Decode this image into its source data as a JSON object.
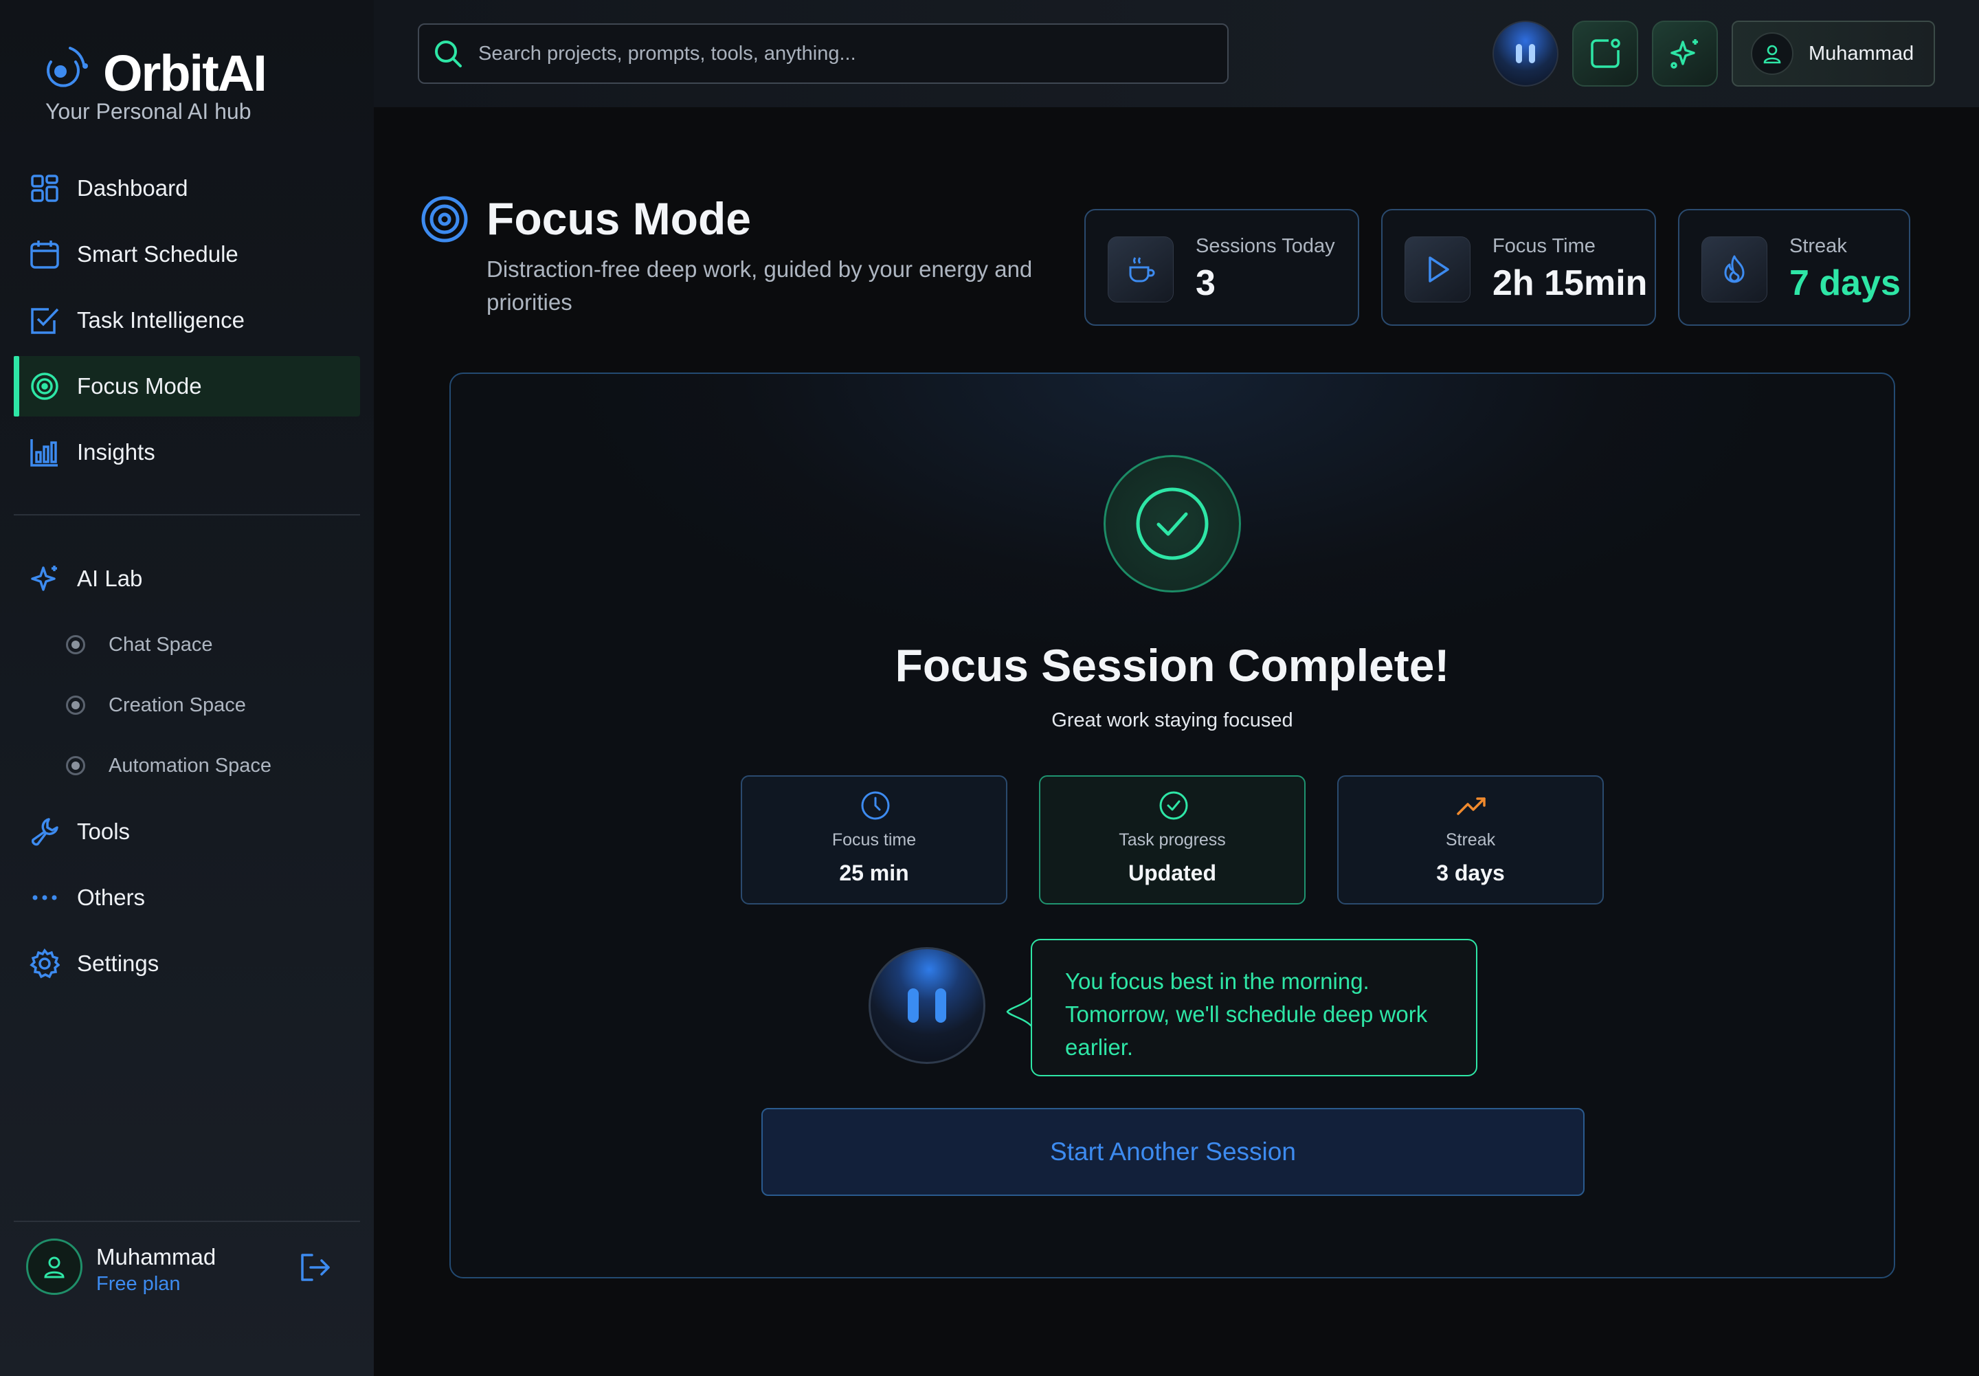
{
  "brand": {
    "name": "OrbitAI",
    "tagline": "Your Personal AI hub"
  },
  "nav": {
    "items": [
      {
        "label": "Dashboard",
        "icon": "dashboard-grid-icon"
      },
      {
        "label": "Smart Schedule",
        "icon": "calendar-icon"
      },
      {
        "label": "Task Intelligence",
        "icon": "task-check-icon"
      },
      {
        "label": "Focus Mode",
        "icon": "target-icon",
        "active": true
      },
      {
        "label": "Insights",
        "icon": "bar-chart-icon"
      }
    ],
    "ai_lab": {
      "label": "AI Lab",
      "icon": "sparkle-icon",
      "children": [
        {
          "label": "Chat Space"
        },
        {
          "label": "Creation Space"
        },
        {
          "label": "Automation Space"
        }
      ]
    },
    "bottom_items": [
      {
        "label": "Tools",
        "icon": "wrench-icon"
      },
      {
        "label": "Others",
        "icon": "ellipsis-icon"
      },
      {
        "label": "Settings",
        "icon": "gear-icon"
      }
    ]
  },
  "sidebar_user": {
    "name": "Muhammad",
    "plan": "Free plan"
  },
  "topbar": {
    "search_placeholder": "Search projects, prompts, tools, anything...",
    "user_name": "Muhammad"
  },
  "header": {
    "title": "Focus Mode",
    "subtitle": "Distraction-free deep work, guided by your energy and priorities"
  },
  "stats": [
    {
      "label": "Sessions Today",
      "value": "3",
      "icon": "coffee-cup-icon"
    },
    {
      "label": "Focus Time",
      "value": "2h 15min",
      "icon": "play-icon"
    },
    {
      "label": "Streak",
      "value": "7 days",
      "icon": "flame-icon"
    }
  ],
  "session": {
    "title": "Focus Session Complete!",
    "subtitle": "Great work staying focused",
    "cards": [
      {
        "label": "Focus time",
        "value": "25 min",
        "icon": "clock-icon"
      },
      {
        "label": "Task progress",
        "value": "Updated",
        "icon": "check-circle-icon"
      },
      {
        "label": "Streak",
        "value": "3 days",
        "icon": "trending-up-icon"
      }
    ],
    "assistant_message": "You focus best in the morning. Tomorrow, we'll schedule deep work earlier.",
    "cta_label": "Start Another Session"
  },
  "colors": {
    "accent_green": "#2ee6a6",
    "accent_blue": "#3d8bf0",
    "accent_orange": "#f08a2e",
    "background": "#0b0c0e"
  }
}
